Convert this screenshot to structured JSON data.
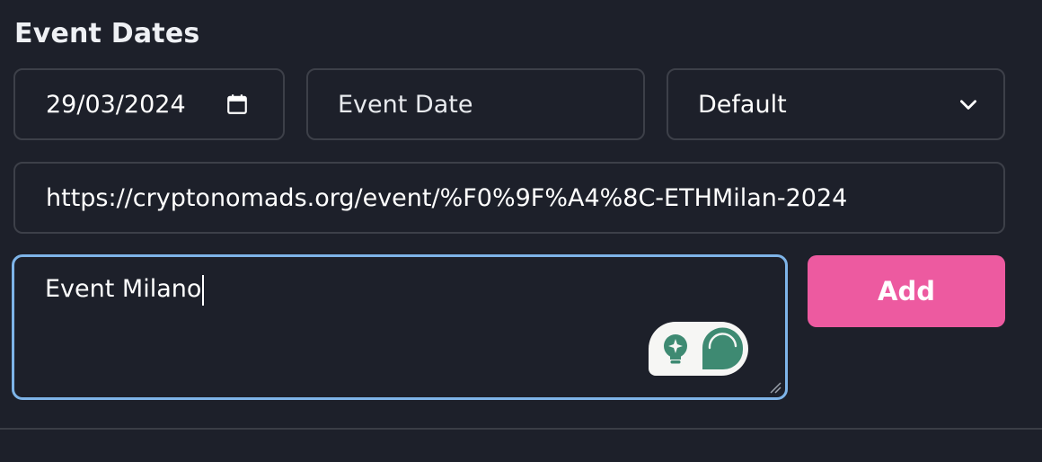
{
  "section": {
    "title": "Event Dates"
  },
  "date_input": {
    "value": "29/03/2024",
    "icon": "calendar-icon"
  },
  "name_input": {
    "placeholder": "Event Date"
  },
  "type_select": {
    "selected": "Default",
    "icon": "chevron-down-icon"
  },
  "url_input": {
    "value": "https://cryptonomads.org/event/%F0%9F%A4%8C-ETHMilan-2024"
  },
  "description_input": {
    "value": "Event Milano",
    "focused": true
  },
  "assistant_widget": {
    "icons": [
      "lightbulb-sparkle-icon",
      "speech-bubble-icon"
    ]
  },
  "add_button": {
    "label": "Add"
  },
  "colors": {
    "background": "#1d202a",
    "border": "#3d4049",
    "focus_border": "#7eb4e8",
    "accent_button": "#ed5aa0",
    "widget_teal": "#3e8a72"
  }
}
